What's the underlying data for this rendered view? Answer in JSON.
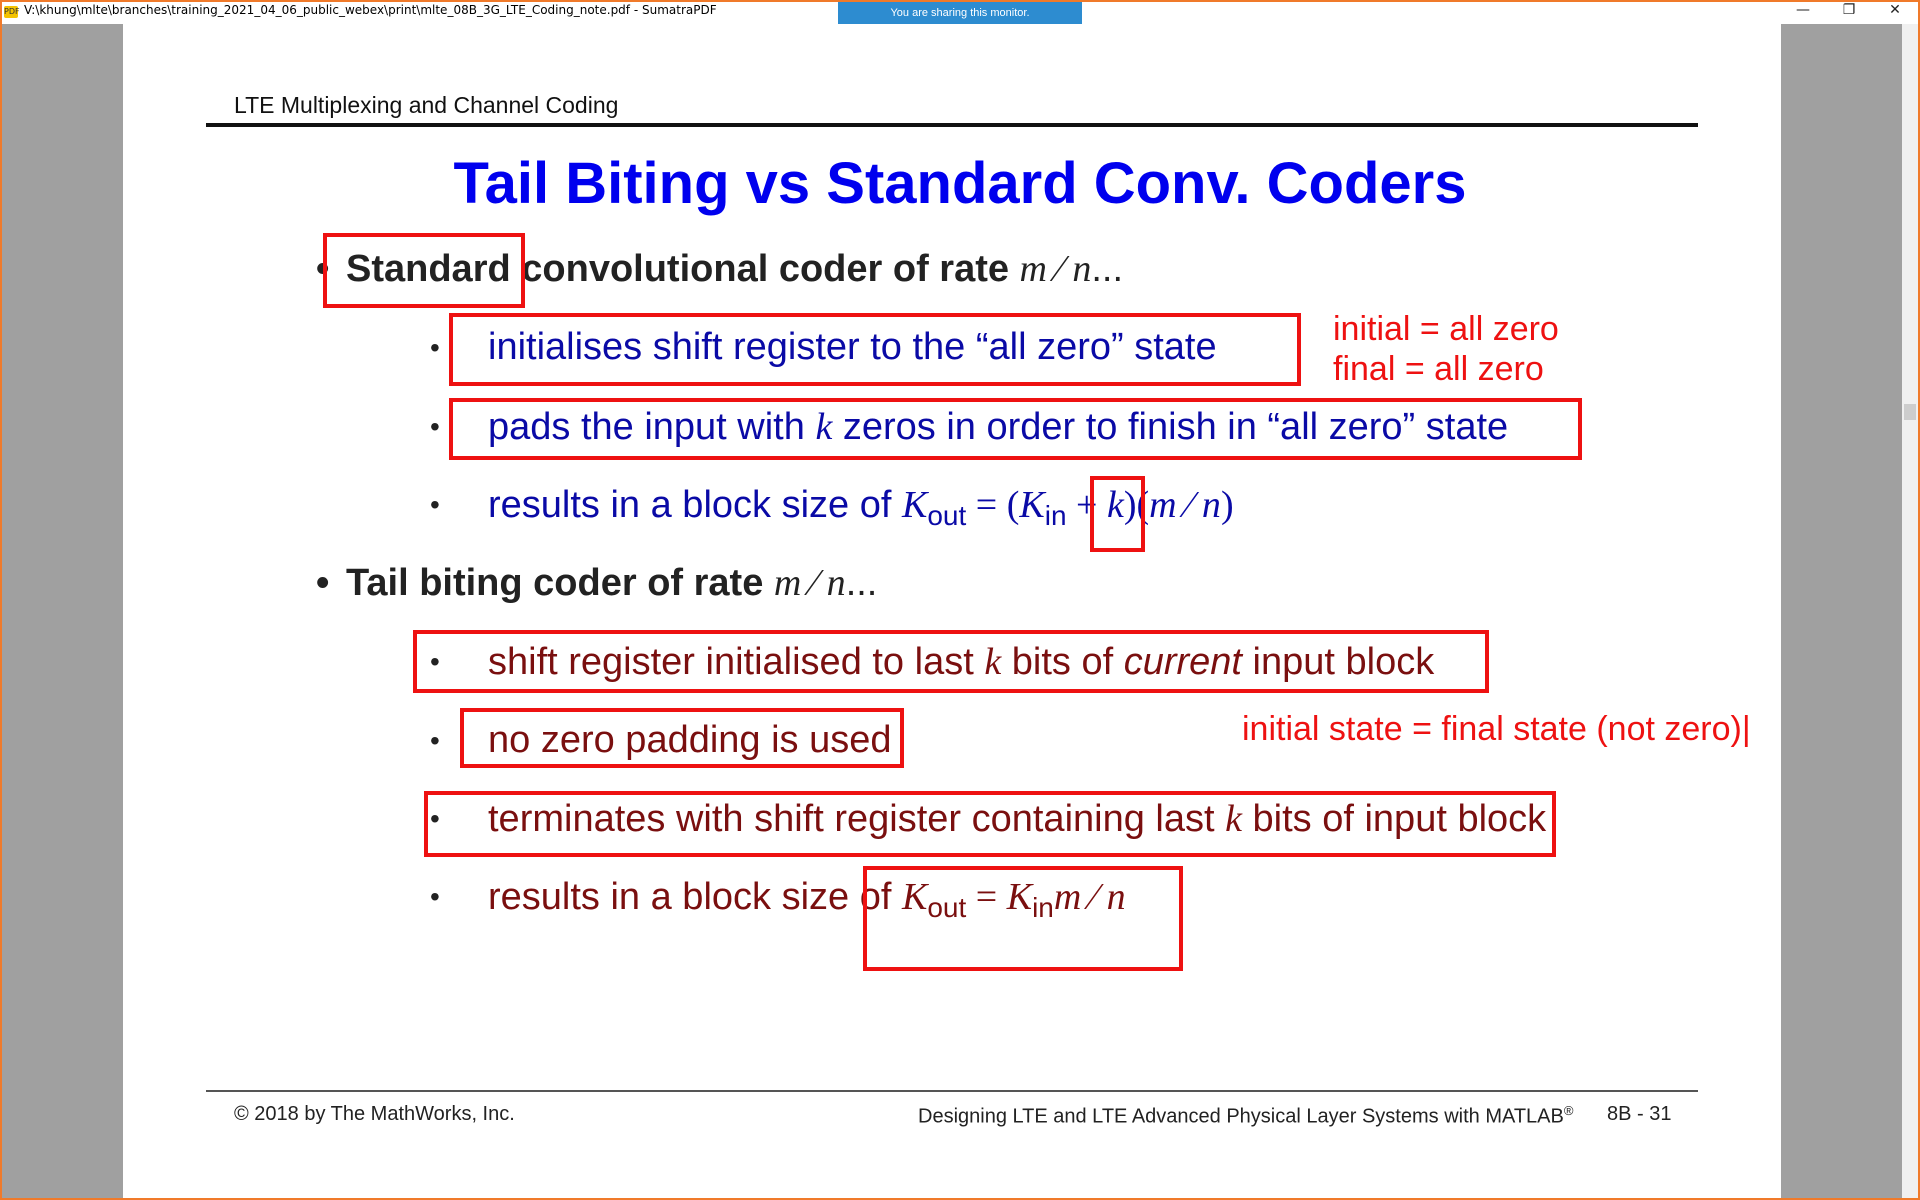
{
  "window": {
    "title": "V:\\khung\\mlte\\branches\\training_2021_04_06_public_webex\\print\\mlte_08B_3G_LTE_Coding_note.pdf - SumatraPDF",
    "app_icon_label": "PDF",
    "sharing_banner": "You are sharing this monitor.",
    "minimize": "—",
    "restore": "❐",
    "close": "✕"
  },
  "slide": {
    "header": "LTE Multiplexing and Channel Coding",
    "title": "Tail Biting vs Standard Conv. Coders",
    "section1": {
      "bullet": "•",
      "lead": "Standard",
      "rest": " convolutional coder of rate ",
      "rate": "m ⁄ n",
      "ellipsis": "...",
      "items": [
        {
          "bullet": "•",
          "text": "initialises shift register to the “all zero” state"
        },
        {
          "bullet": "•",
          "pre": "pads the input with ",
          "var": "k",
          "post": " zeros in order to finish in “all zero” state"
        },
        {
          "bullet": "•",
          "pre": "results in a block size of ",
          "K": "K",
          "out": "out",
          "eq": " = (",
          "K2": "K",
          "in": "in",
          "plus": " + ",
          "k": "k",
          "close": ")(",
          "mn": "m ⁄ n",
          "end": ")"
        }
      ]
    },
    "section2": {
      "bullet": "•",
      "lead": "Tail biting coder of rate ",
      "rate": "m ⁄ n",
      "ellipsis": "...",
      "items": [
        {
          "bullet": "•",
          "pre": "shift register initialised to last ",
          "var": "k",
          "mid": " bits of ",
          "em": "current",
          "post": " input block"
        },
        {
          "bullet": "•",
          "text": "no zero padding is used"
        },
        {
          "bullet": "•",
          "pre": "terminates with shift register containing last ",
          "var": "k",
          "post": " bits of input block"
        },
        {
          "bullet": "•",
          "pre": "results in a block size of ",
          "K": "K",
          "out": "out",
          "eq": " = ",
          "K2": "K",
          "in": "in",
          "mn": "m ⁄ n"
        }
      ]
    },
    "annotations": {
      "initial": "initial = all zero",
      "final": "final = all zero",
      "tail": "initial state = final state (not zero)|"
    },
    "footer": {
      "copyright": "© 2018 by The MathWorks, Inc.",
      "course": "Designing LTE and LTE Advanced Physical Layer Systems with MATLAB",
      "reg": "®",
      "page": "8B - 31"
    },
    "colors": {
      "title": "#0000ee",
      "standard_items": "#0a0aa6",
      "tail_items": "#7a0f0f",
      "annotation": "#ee1111",
      "window_border": "#f07a2a"
    }
  }
}
